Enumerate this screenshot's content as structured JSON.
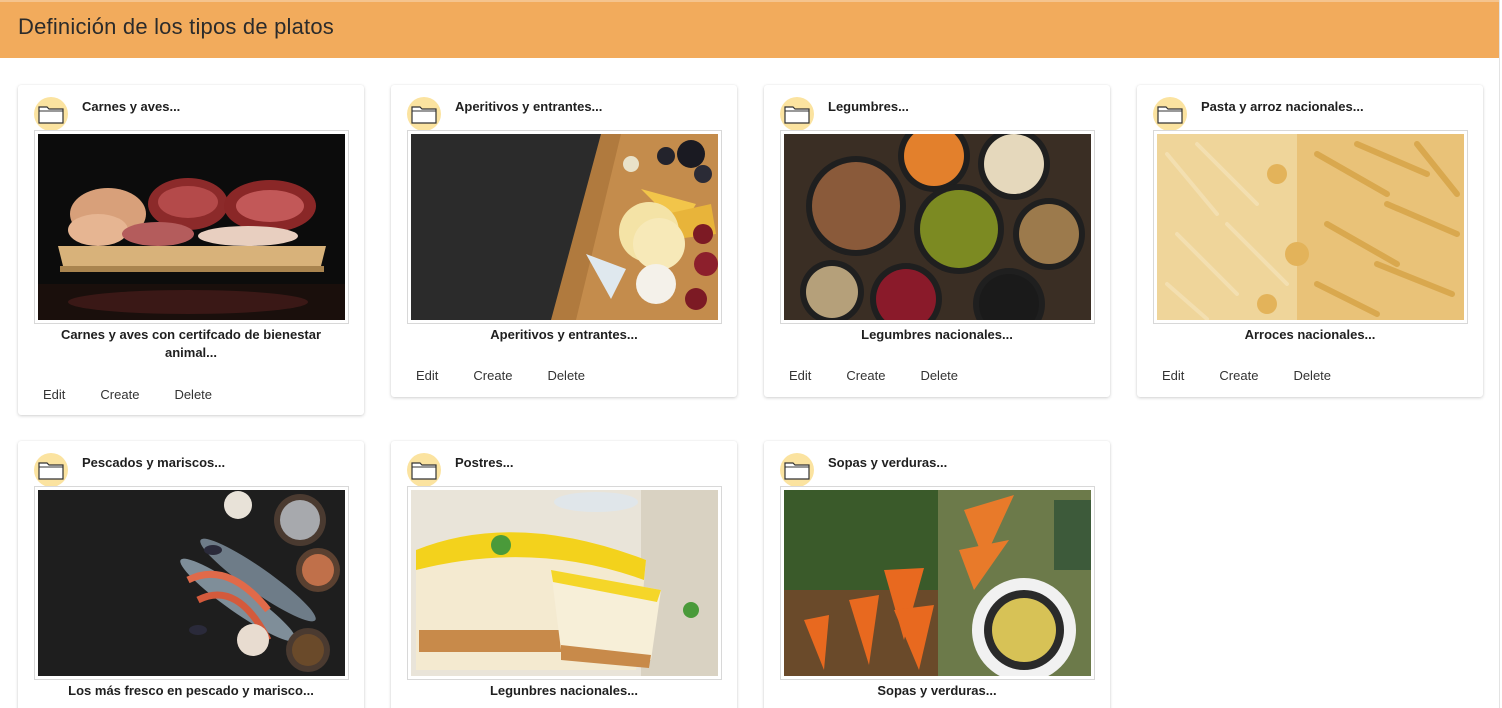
{
  "header": {
    "title": "Definición de los tipos de platos"
  },
  "actions": {
    "edit": "Edit",
    "create": "Create",
    "delete": "Delete"
  },
  "cards": [
    {
      "title": "Carnes y aves...",
      "description": "Carnes y aves con certifcado de bienestar animal...",
      "image": "meat-photo"
    },
    {
      "title": "Aperitivos y entrantes...",
      "description": "Aperitivos y entrantes...",
      "image": "cheese-board-photo"
    },
    {
      "title": "Legumbres...",
      "description": "Legumbres nacionales...",
      "image": "legumes-bowls-photo"
    },
    {
      "title": "Pasta y arroz nacionales...",
      "description": "Arroces nacionales...",
      "image": "pasta-photo"
    },
    {
      "title": "Pescados y mariscos...",
      "description": "Los más fresco en pescado y marisco...",
      "image": "seafood-photo"
    },
    {
      "title": "Postres...",
      "description": "Legunbres nacionales...",
      "image": "cheesecake-photo"
    },
    {
      "title": "Sopas y verduras...",
      "description": "Sopas y verduras...",
      "image": "carrots-soup-photo"
    }
  ]
}
